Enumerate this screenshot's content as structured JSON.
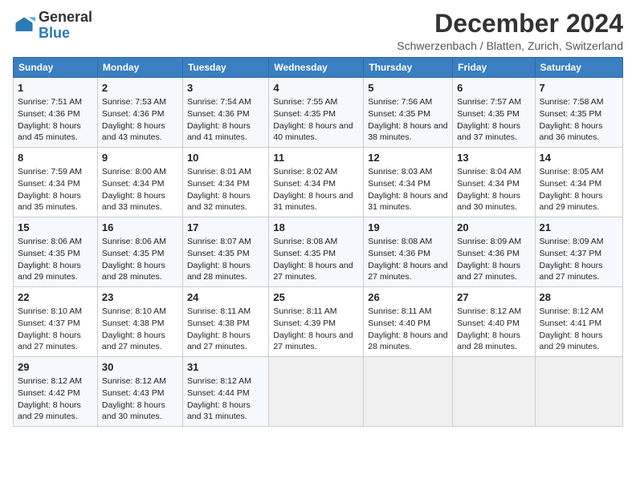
{
  "logo": {
    "text1": "General",
    "text2": "Blue"
  },
  "title": "December 2024",
  "subtitle": "Schwerzenbach / Blatten, Zurich, Switzerland",
  "headers": [
    "Sunday",
    "Monday",
    "Tuesday",
    "Wednesday",
    "Thursday",
    "Friday",
    "Saturday"
  ],
  "weeks": [
    [
      {
        "day": "1",
        "sunrise": "7:51 AM",
        "sunset": "4:36 PM",
        "daylight": "8 hours and 45 minutes."
      },
      {
        "day": "2",
        "sunrise": "7:53 AM",
        "sunset": "4:36 PM",
        "daylight": "8 hours and 43 minutes."
      },
      {
        "day": "3",
        "sunrise": "7:54 AM",
        "sunset": "4:36 PM",
        "daylight": "8 hours and 41 minutes."
      },
      {
        "day": "4",
        "sunrise": "7:55 AM",
        "sunset": "4:35 PM",
        "daylight": "8 hours and 40 minutes."
      },
      {
        "day": "5",
        "sunrise": "7:56 AM",
        "sunset": "4:35 PM",
        "daylight": "8 hours and 38 minutes."
      },
      {
        "day": "6",
        "sunrise": "7:57 AM",
        "sunset": "4:35 PM",
        "daylight": "8 hours and 37 minutes."
      },
      {
        "day": "7",
        "sunrise": "7:58 AM",
        "sunset": "4:35 PM",
        "daylight": "8 hours and 36 minutes."
      }
    ],
    [
      {
        "day": "8",
        "sunrise": "7:59 AM",
        "sunset": "4:34 PM",
        "daylight": "8 hours and 35 minutes."
      },
      {
        "day": "9",
        "sunrise": "8:00 AM",
        "sunset": "4:34 PM",
        "daylight": "8 hours and 33 minutes."
      },
      {
        "day": "10",
        "sunrise": "8:01 AM",
        "sunset": "4:34 PM",
        "daylight": "8 hours and 32 minutes."
      },
      {
        "day": "11",
        "sunrise": "8:02 AM",
        "sunset": "4:34 PM",
        "daylight": "8 hours and 31 minutes."
      },
      {
        "day": "12",
        "sunrise": "8:03 AM",
        "sunset": "4:34 PM",
        "daylight": "8 hours and 31 minutes."
      },
      {
        "day": "13",
        "sunrise": "8:04 AM",
        "sunset": "4:34 PM",
        "daylight": "8 hours and 30 minutes."
      },
      {
        "day": "14",
        "sunrise": "8:05 AM",
        "sunset": "4:34 PM",
        "daylight": "8 hours and 29 minutes."
      }
    ],
    [
      {
        "day": "15",
        "sunrise": "8:06 AM",
        "sunset": "4:35 PM",
        "daylight": "8 hours and 29 minutes."
      },
      {
        "day": "16",
        "sunrise": "8:06 AM",
        "sunset": "4:35 PM",
        "daylight": "8 hours and 28 minutes."
      },
      {
        "day": "17",
        "sunrise": "8:07 AM",
        "sunset": "4:35 PM",
        "daylight": "8 hours and 28 minutes."
      },
      {
        "day": "18",
        "sunrise": "8:08 AM",
        "sunset": "4:35 PM",
        "daylight": "8 hours and 27 minutes."
      },
      {
        "day": "19",
        "sunrise": "8:08 AM",
        "sunset": "4:36 PM",
        "daylight": "8 hours and 27 minutes."
      },
      {
        "day": "20",
        "sunrise": "8:09 AM",
        "sunset": "4:36 PM",
        "daylight": "8 hours and 27 minutes."
      },
      {
        "day": "21",
        "sunrise": "8:09 AM",
        "sunset": "4:37 PM",
        "daylight": "8 hours and 27 minutes."
      }
    ],
    [
      {
        "day": "22",
        "sunrise": "8:10 AM",
        "sunset": "4:37 PM",
        "daylight": "8 hours and 27 minutes."
      },
      {
        "day": "23",
        "sunrise": "8:10 AM",
        "sunset": "4:38 PM",
        "daylight": "8 hours and 27 minutes."
      },
      {
        "day": "24",
        "sunrise": "8:11 AM",
        "sunset": "4:38 PM",
        "daylight": "8 hours and 27 minutes."
      },
      {
        "day": "25",
        "sunrise": "8:11 AM",
        "sunset": "4:39 PM",
        "daylight": "8 hours and 27 minutes."
      },
      {
        "day": "26",
        "sunrise": "8:11 AM",
        "sunset": "4:40 PM",
        "daylight": "8 hours and 28 minutes."
      },
      {
        "day": "27",
        "sunrise": "8:12 AM",
        "sunset": "4:40 PM",
        "daylight": "8 hours and 28 minutes."
      },
      {
        "day": "28",
        "sunrise": "8:12 AM",
        "sunset": "4:41 PM",
        "daylight": "8 hours and 29 minutes."
      }
    ],
    [
      {
        "day": "29",
        "sunrise": "8:12 AM",
        "sunset": "4:42 PM",
        "daylight": "8 hours and 29 minutes."
      },
      {
        "day": "30",
        "sunrise": "8:12 AM",
        "sunset": "4:43 PM",
        "daylight": "8 hours and 30 minutes."
      },
      {
        "day": "31",
        "sunrise": "8:12 AM",
        "sunset": "4:44 PM",
        "daylight": "8 hours and 31 minutes."
      },
      null,
      null,
      null,
      null
    ]
  ],
  "labels": {
    "sunrise": "Sunrise:",
    "sunset": "Sunset:",
    "daylight": "Daylight:"
  }
}
